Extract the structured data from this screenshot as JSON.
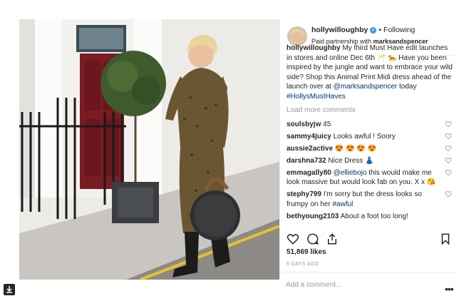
{
  "header": {
    "username": "hollywilloughby",
    "following_label": "Following",
    "partnership_prefix": "Paid partnership with",
    "partner": "marksandspencer"
  },
  "caption": {
    "username": "hollywilloughby",
    "text_a": " My third Must Have edit launches in stores and online Dec 6th 🥂 🐆 Have you been inspired by the jungle and want to embrace your wild side? Shop this Animal Print Midi dress ahead of the launch over at ",
    "mention": "@marksandspencer",
    "text_b": " today ",
    "hashtag": "#HollysMustHaves"
  },
  "load_more": "Load more comments",
  "comments": [
    {
      "user": "soulsbyjw",
      "text": "45"
    },
    {
      "user": "sammy4juicy",
      "text": "Looks awful ! Soory"
    },
    {
      "user": "aussie2active",
      "text": "😍 😍 😍 😍"
    },
    {
      "user": "darshna732",
      "text": "Nice Dress 👗"
    },
    {
      "user": "emmagally80",
      "mention": "@elliebojo",
      "text": " this would make me look massive but would look fab on you. X x 😘"
    },
    {
      "user": "stephy799",
      "text": "I'm sorry but the dress looks so frumpy on her ",
      "hashtag": "#awful"
    },
    {
      "user": "bethyoung2103",
      "text": "About a foot too long!"
    }
  ],
  "likes": "51,869 likes",
  "time_ago": "6 DAYS AGO",
  "add_comment_placeholder": "Add a comment...",
  "more_icon": "•••",
  "icons": [
    "verified-icon",
    "heart-icon",
    "comment-icon",
    "share-icon",
    "bookmark-icon",
    "more-icon"
  ],
  "colors": {
    "link": "#003569",
    "verified": "#3897f0",
    "muted": "#999999",
    "text": "#262626"
  }
}
